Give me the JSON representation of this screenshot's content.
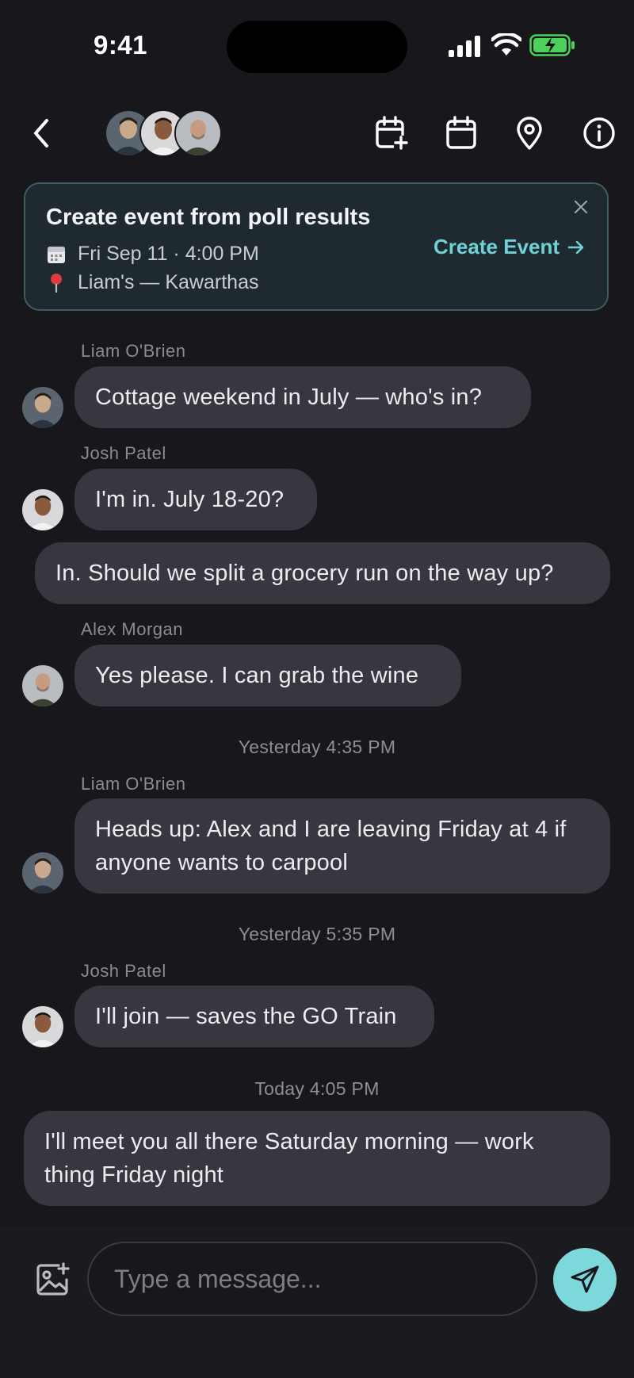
{
  "status_bar": {
    "time": "9:41"
  },
  "header": {
    "back_icon": "chevron-left-icon",
    "icons": [
      "calendar-add-icon",
      "calendar-icon",
      "location-pin-icon",
      "info-icon"
    ]
  },
  "banner": {
    "title": "Create event from poll results",
    "date": "Fri Sep 11 · 4:00 PM",
    "location": "Liam's — Kawarthas",
    "cta": "Create Event",
    "accent_color": "#6fd2d6"
  },
  "messages": [
    {
      "sender": "Liam O'Brien",
      "text": "Cottage weekend in July — who's in?"
    },
    {
      "sender": "Josh Patel",
      "text": "I'm in. July 18-20?"
    },
    {
      "sender": "",
      "text": "In. Should we split a grocery run on the way up?"
    },
    {
      "sender": "Alex Morgan",
      "text": "Yes please. I can grab the wine"
    },
    {
      "timestamp": "Yesterday 4:35 PM"
    },
    {
      "sender": "Liam O'Brien",
      "text": "Heads up: Alex and I are leaving Friday at 4 if anyone wants to carpool"
    },
    {
      "timestamp": "Yesterday 5:35 PM"
    },
    {
      "sender": "Josh Patel",
      "text": "I'll join — saves the GO Train"
    },
    {
      "timestamp": "Today 4:05 PM"
    },
    {
      "sender": "",
      "text": "I'll meet you all there Saturday morning — work thing Friday night"
    }
  ],
  "composer": {
    "placeholder": "Type a message...",
    "value": "",
    "send_color": "#7dd8dc"
  }
}
